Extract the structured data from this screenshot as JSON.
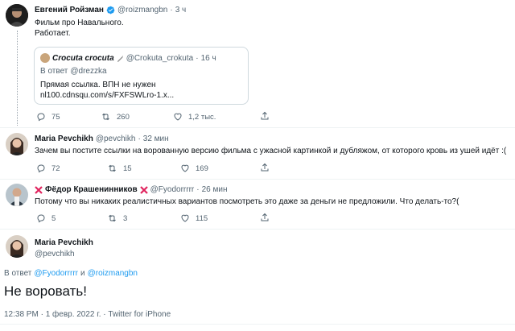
{
  "tweet1": {
    "name": "Евгений Ройзман",
    "handle": "@roizmangbn",
    "dot": "·",
    "time": "3 ч",
    "lines": [
      "Фильм про Навального.",
      "Работает."
    ],
    "quote": {
      "name": "Crocuta crocuta",
      "handle": "@Crokuta_crokuta",
      "dot": "·",
      "time": "16 ч",
      "reply_prefix": "В ответ",
      "reply_to": "@drezzka",
      "lines": [
        "Прямая ссылка. ВПН не нужен",
        "nl100.cdnsqu.com/s/FXFSWLro-1.x..."
      ]
    },
    "actions": {
      "replies": "75",
      "retweets": "260",
      "likes": "1,2 тыс."
    }
  },
  "tweet2": {
    "name": "Maria Pevchikh",
    "handle": "@pevchikh",
    "dot": "·",
    "time": "32 мин",
    "text": "Зачем вы постите ссылки на ворованную версию фильма с ужасной картинкой и дубляжом, от которого кровь из ушей идёт :(",
    "actions": {
      "replies": "72",
      "retweets": "15",
      "likes": "169"
    }
  },
  "tweet3": {
    "name": "Фёдор Крашенинников",
    "handle": "@Fyodorrrrr",
    "dot": "·",
    "time": "26 мин",
    "text": "Потому что вы никаких реалистичных вариантов посмотреть это даже за деньги не предложили. Что делать-то?(",
    "actions": {
      "replies": "5",
      "retweets": "3",
      "likes": "115"
    }
  },
  "main": {
    "name": "Maria Pevchikh",
    "handle": "@pevchikh",
    "reply_prefix": "В ответ",
    "reply_to_1": "@Fyodorrrrr",
    "reply_and": "и",
    "reply_to_2": "@roizmangbn",
    "text": "Не воровать!",
    "meta": "12:38 PM · 1 февр. 2022 г. · Twitter for iPhone"
  },
  "colors": {
    "accent": "#1d9bf0",
    "muted": "#536471",
    "verified": "#1d9bf0",
    "flag_red": "#e0245e"
  }
}
